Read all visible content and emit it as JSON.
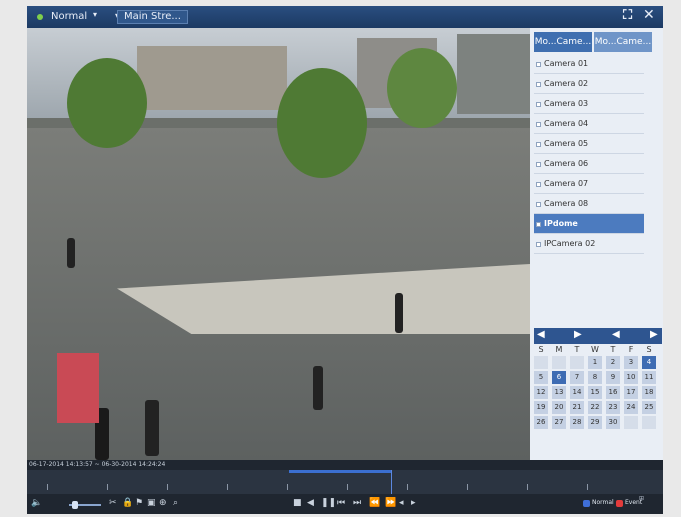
{
  "titlebar": {
    "mode": "Normal",
    "stream": "Main Stre..."
  },
  "tabs": [
    "Mo...Came...",
    "Mo...Came..."
  ],
  "cameras": [
    {
      "label": "Camera 01",
      "selected": false
    },
    {
      "label": "Camera 02",
      "selected": false
    },
    {
      "label": "Camera 03",
      "selected": false
    },
    {
      "label": "Camera 04",
      "selected": false
    },
    {
      "label": "Camera 05",
      "selected": false
    },
    {
      "label": "Camera 06",
      "selected": false
    },
    {
      "label": "Camera 07",
      "selected": false
    },
    {
      "label": "Camera 08",
      "selected": false
    },
    {
      "label": "IPdome",
      "selected": true
    },
    {
      "label": "IPCamera 02",
      "selected": false
    }
  ],
  "calendar": {
    "days_header": [
      "S",
      "M",
      "T",
      "W",
      "T",
      "F",
      "S"
    ],
    "rows": [
      [
        "",
        "",
        "",
        "1",
        "2",
        "3",
        "4"
      ],
      [
        "5",
        "6",
        "7",
        "8",
        "9",
        "10",
        "11"
      ],
      [
        "12",
        "13",
        "14",
        "15",
        "16",
        "17",
        "18"
      ],
      [
        "19",
        "20",
        "21",
        "22",
        "23",
        "24",
        "25"
      ],
      [
        "26",
        "27",
        "28",
        "29",
        "30",
        "",
        ""
      ]
    ],
    "selected_days": [
      "4",
      "6"
    ]
  },
  "timeline": {
    "timestamp": "06-17-2014 14:13:57 ~ 06-30-2014 14:24:24"
  },
  "legend": {
    "normal": "Normal",
    "event": "Event",
    "normal_color": "#3f6fd8",
    "event_color": "#e33b3b"
  }
}
